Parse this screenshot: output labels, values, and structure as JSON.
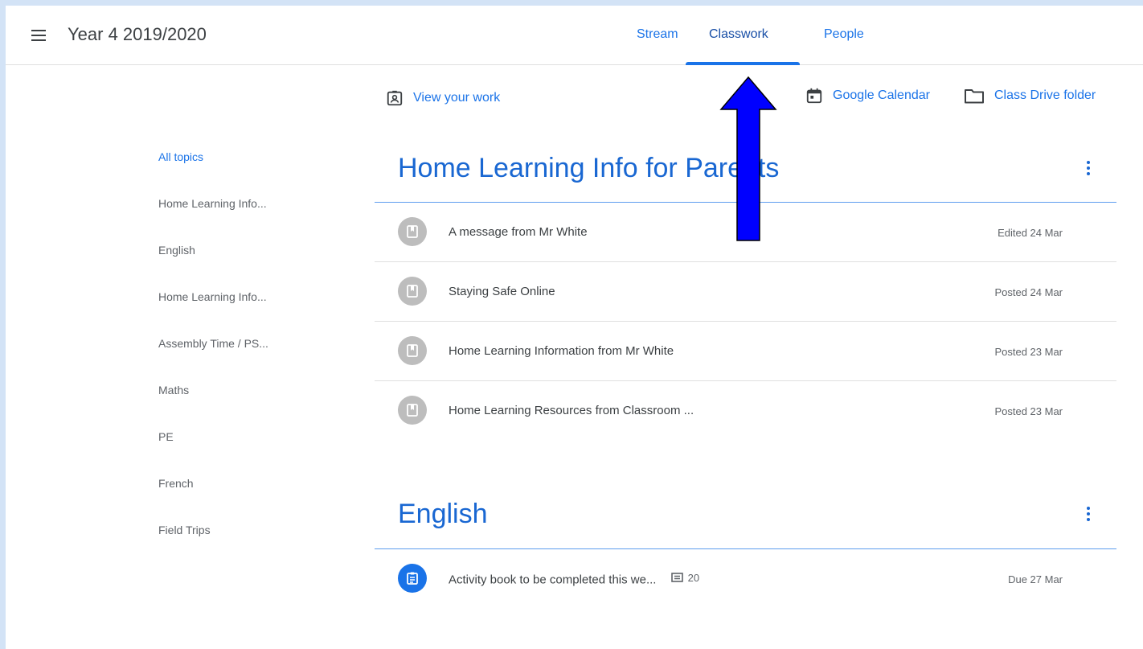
{
  "header": {
    "class_title": "Year 4 2019/2020",
    "tabs": [
      {
        "label": "Stream"
      },
      {
        "label": "Classwork",
        "selected": true
      },
      {
        "label": "People"
      }
    ]
  },
  "toolbar": {
    "view_your_work": "View your work",
    "google_calendar": "Google Calendar",
    "class_drive_folder": "Class Drive folder"
  },
  "sidebar": {
    "topics": [
      {
        "label": "All topics",
        "active": true
      },
      {
        "label": "Home Learning Info..."
      },
      {
        "label": "English"
      },
      {
        "label": "Home Learning Info..."
      },
      {
        "label": "Assembly Time / PS..."
      },
      {
        "label": "Maths"
      },
      {
        "label": "PE"
      },
      {
        "label": "French"
      },
      {
        "label": "Field Trips"
      }
    ]
  },
  "sections": [
    {
      "title": "Home Learning Info for Parents",
      "items": [
        {
          "title": "A message from Mr White",
          "meta": "Edited 24 Mar",
          "icon": "material-icon"
        },
        {
          "title": "Staying Safe Online",
          "meta": "Posted 24 Mar",
          "icon": "material-icon"
        },
        {
          "title": "Home Learning Information from Mr White",
          "meta": "Posted 23 Mar",
          "icon": "material-icon"
        },
        {
          "title": "Home Learning Resources from Classroom ...",
          "meta": "Posted 23 Mar",
          "icon": "material-icon"
        }
      ]
    },
    {
      "title": "English",
      "items": [
        {
          "title": "Activity book to be completed this we...",
          "comments": "20",
          "meta": "Due 27 Mar",
          "icon": "assignment-icon"
        }
      ]
    }
  ],
  "colors": {
    "accent": "#1a73e8",
    "section_title": "#1967d2",
    "annotation_arrow": "#0000ff",
    "background_frame": "#d3e3f6"
  }
}
